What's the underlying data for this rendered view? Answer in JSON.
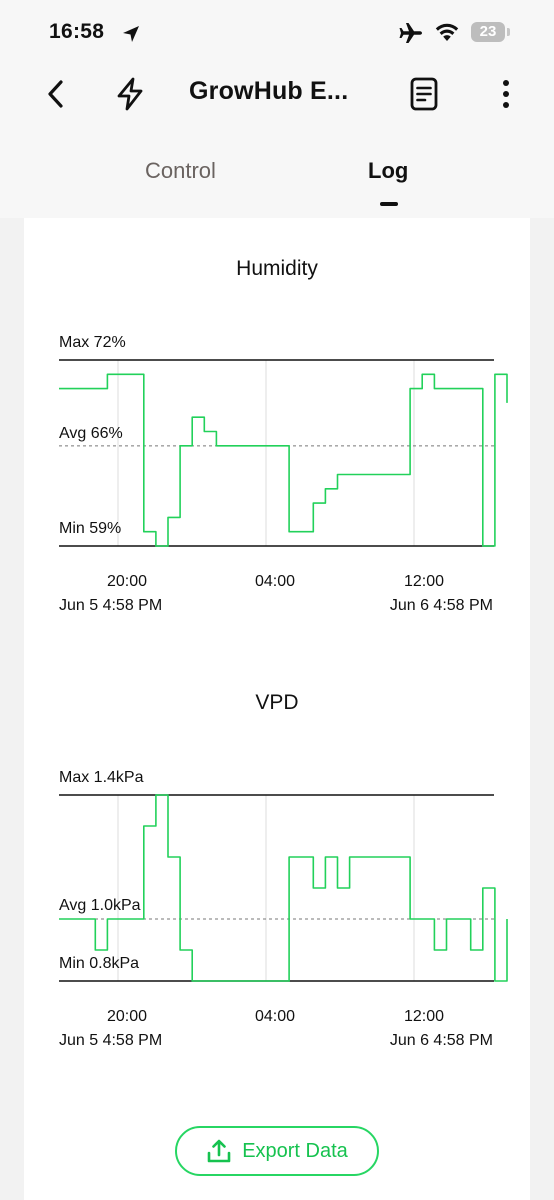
{
  "status_bar": {
    "time": "16:58",
    "battery": "23"
  },
  "header": {
    "title": "GrowHub E..."
  },
  "tabs": [
    {
      "label": "Control"
    },
    {
      "label": "Log"
    }
  ],
  "colors": {
    "line": "#22d15a",
    "accent": "#16c24f"
  },
  "charts": [
    {
      "title": "Humidity",
      "max_label": "Max 72%",
      "avg_label": "Avg 66%",
      "min_label": "Min 59%",
      "x_ticks": [
        "20:00",
        "04:00",
        "12:00"
      ],
      "start_label": "Jun 5 4:58 PM",
      "end_label": "Jun 6 4:58 PM"
    },
    {
      "title": "VPD",
      "max_label": "Max 1.4kPa",
      "avg_label": "Avg 1.0kPa",
      "min_label": "Min 0.8kPa",
      "x_ticks": [
        "20:00",
        "04:00",
        "12:00"
      ],
      "start_label": "Jun 5 4:58 PM",
      "end_label": "Jun 6 4:58 PM"
    }
  ],
  "chart_data": [
    {
      "type": "line",
      "title": "Humidity",
      "x": [
        "Jun 5 16:58",
        "17:30",
        "18:00",
        "18:30",
        "19:00",
        "19:30",
        "20:00",
        "20:30",
        "21:00",
        "21:30",
        "22:00",
        "22:30",
        "23:00",
        "23:30",
        "00:00",
        "01:00",
        "02:00",
        "03:00",
        "04:00",
        "04:30",
        "05:00",
        "05:30",
        "06:00",
        "07:00",
        "08:00",
        "09:00",
        "10:00",
        "11:00",
        "11:30",
        "12:00",
        "13:00",
        "14:00",
        "14:30",
        "15:00",
        "15:30",
        "16:00",
        "16:30",
        "Jun 6 16:58"
      ],
      "series": [
        {
          "values": [
            70,
            70,
            70,
            70,
            71,
            71,
            71,
            60,
            59,
            61,
            66,
            68,
            67,
            66,
            66,
            66,
            66,
            66,
            66,
            60,
            60,
            62,
            63,
            64,
            64,
            64,
            64,
            64,
            64,
            70,
            71,
            70,
            70,
            70,
            70,
            59,
            71,
            69
          ]
        }
      ],
      "max": 72,
      "avg": 66,
      "min": 59,
      "x_ticks": [
        "20:00",
        "04:00",
        "12:00"
      ]
    },
    {
      "type": "line",
      "title": "VPD",
      "x": [
        "Jun 5 16:58",
        "17:30",
        "18:00",
        "18:30",
        "19:00",
        "19:30",
        "20:00",
        "20:30",
        "21:00",
        "21:30",
        "22:00",
        "22:30",
        "23:00",
        "23:30",
        "00:00",
        "01:00",
        "02:00",
        "03:00",
        "04:00",
        "04:30",
        "05:00",
        "05:30",
        "06:00",
        "07:00",
        "08:00",
        "09:00",
        "10:00",
        "11:00",
        "11:30",
        "12:00",
        "13:00",
        "14:00",
        "14:30",
        "15:00",
        "15:30",
        "16:00",
        "16:30",
        "Jun 6 16:58"
      ],
      "series": [
        {
          "values": [
            1.0,
            1.0,
            1.0,
            0.9,
            1.0,
            1.0,
            1.0,
            1.3,
            1.4,
            1.2,
            0.9,
            0.8,
            0.8,
            0.8,
            0.8,
            0.8,
            0.8,
            0.8,
            0.8,
            1.2,
            1.2,
            1.1,
            1.2,
            1.1,
            1.2,
            1.2,
            1.2,
            1.2,
            1.2,
            1.0,
            1.0,
            0.9,
            1.0,
            1.0,
            0.9,
            1.1,
            0.8,
            1.0
          ]
        }
      ],
      "max": 1.4,
      "avg": 1.0,
      "min": 0.8,
      "x_ticks": [
        "20:00",
        "04:00",
        "12:00"
      ]
    }
  ],
  "export": {
    "label": "Export Data"
  }
}
